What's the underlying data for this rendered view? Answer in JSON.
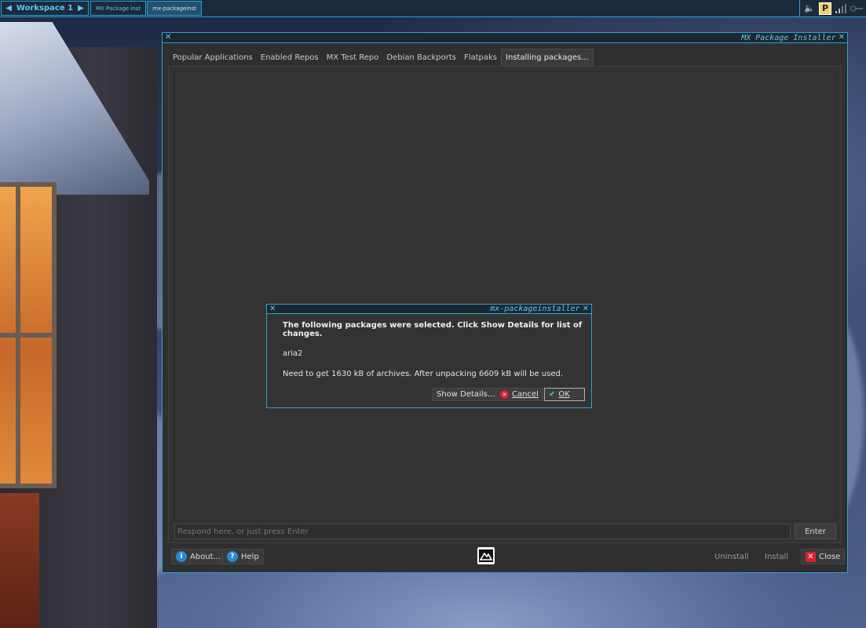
{
  "taskbar": {
    "workspace_label": "Workspace 1",
    "tasks": [
      {
        "label": "MX Package Inst",
        "active": false
      },
      {
        "label": "mx-packageinst",
        "active": true
      }
    ],
    "tray_icons": [
      "speaker-icon",
      "p-badge-icon",
      "signal-icon",
      "key-icon"
    ]
  },
  "main_window": {
    "title": "MX Package Installer",
    "tabs": [
      {
        "label": "Popular Applications"
      },
      {
        "label": "Enabled Repos"
      },
      {
        "label": "MX Test Repo"
      },
      {
        "label": "Debian Backports"
      },
      {
        "label": "Flatpaks"
      },
      {
        "label": "Installing packages..."
      }
    ],
    "active_tab": "Installing packages...",
    "respond_placeholder": "Respond here, or just press Enter",
    "enter_label": "Enter",
    "bottom": {
      "about_label": "About...",
      "help_label": "Help",
      "uninstall_label": "Uninstall",
      "install_label": "Install",
      "close_label": "Close"
    }
  },
  "dialog": {
    "title": "mx-packageinstaller",
    "message": "The following packages were selected. Click Show Details for list of changes.",
    "package": "aria2",
    "need": "Need to get 1630 kB of archives. After unpacking 6609 kB will be used.",
    "show_details_label": "Show Details...",
    "cancel_label": "Cancel",
    "ok_label": "OK"
  },
  "colors": {
    "accent": "#2aa3d6",
    "title_text": "#5ec8f2",
    "window_bg": "#2f2f2f",
    "close_red": "#d92030",
    "info_blue": "#2d88d2"
  }
}
